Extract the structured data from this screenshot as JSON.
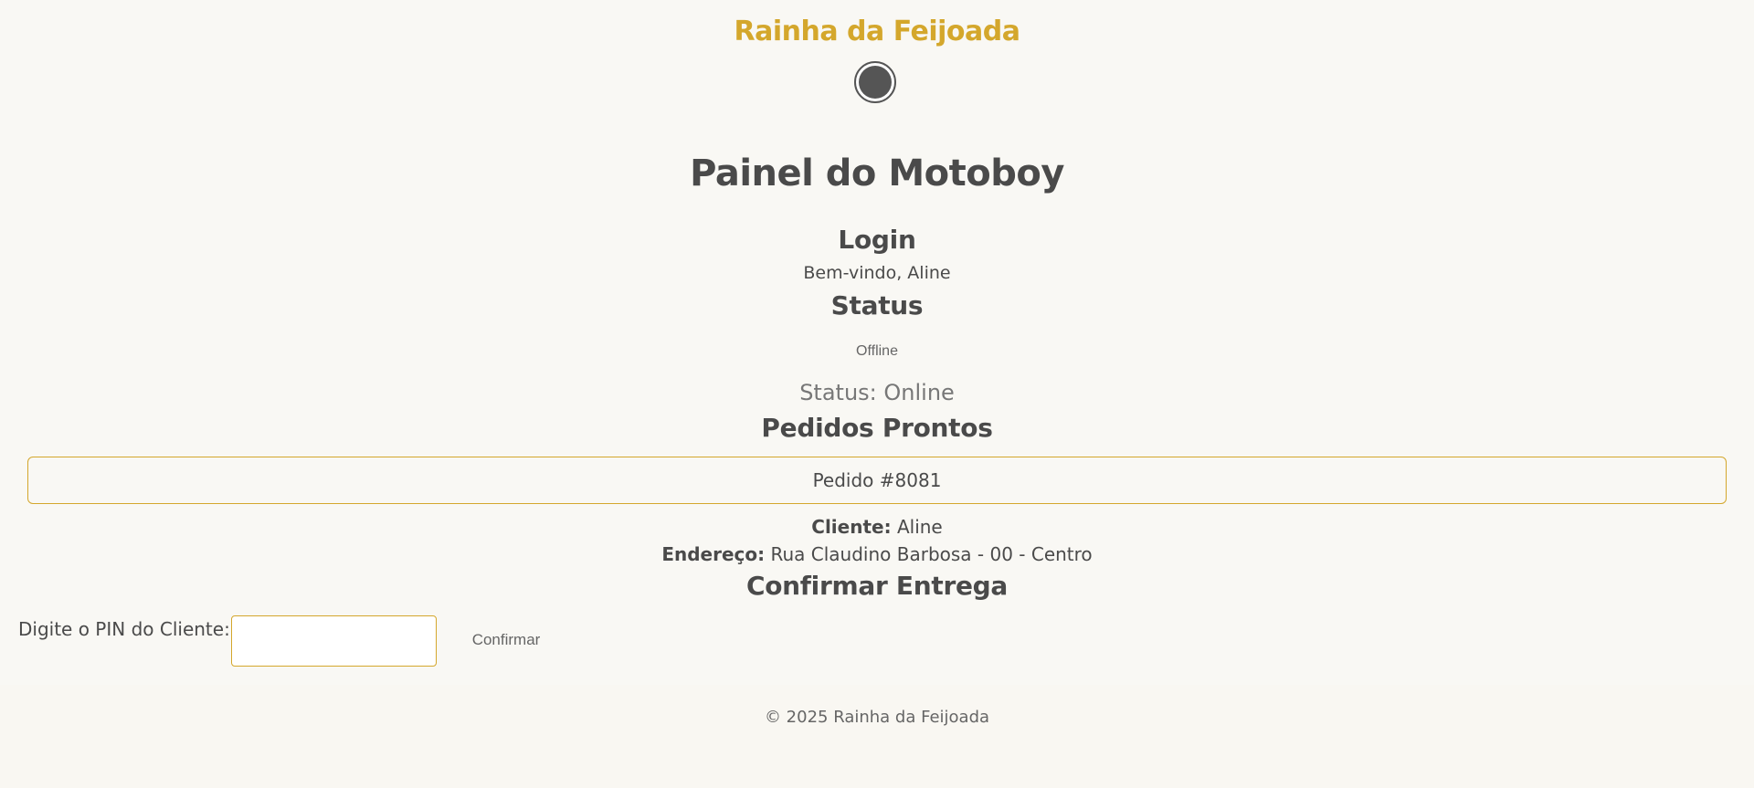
{
  "header": {
    "brand": "Rainha da Feijoada",
    "logo_icon": "logo-icon"
  },
  "main": {
    "page_title": "Painel do Motoboy",
    "login": {
      "title": "Login",
      "welcome": "Bem-vindo, Aline"
    },
    "status": {
      "title": "Status",
      "toggle_label": "Offline",
      "status_text": "Status: Online"
    },
    "pedidos": {
      "title": "Pedidos Prontos",
      "orders": [
        {
          "label": "Pedido #8081",
          "cliente_label": "Cliente:",
          "cliente_value": "Aline",
          "endereco_label": "Endereço:",
          "endereco_value": "Rua Claudino Barbosa - 00 - Centro"
        }
      ]
    },
    "confirm": {
      "title": "Confirmar Entrega",
      "pin_label": "Digite o PIN do Cliente:",
      "pin_value": "",
      "pin_placeholder": "",
      "button_label": "Confirmar"
    }
  },
  "footer": {
    "text": "© 2025 Rainha da Feijoada"
  },
  "colors": {
    "accent": "#d4a72c",
    "text": "#4a4a4a",
    "background": "#f9f7f2"
  }
}
